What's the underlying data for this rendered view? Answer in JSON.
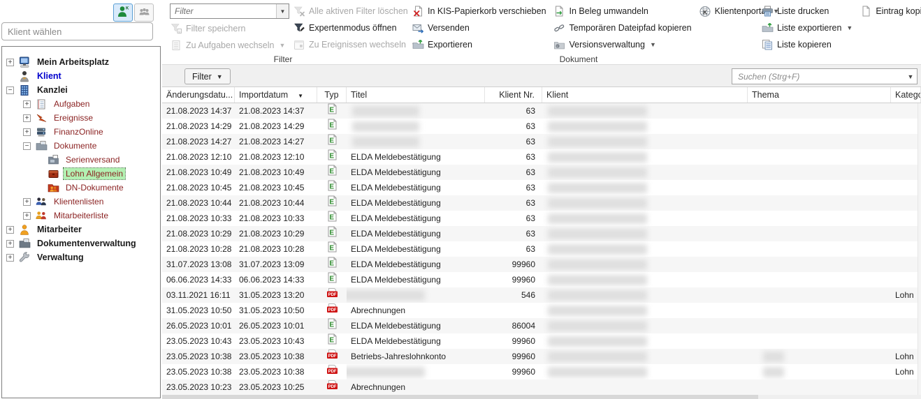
{
  "colors": {
    "accent_selected_tree": "#b2f0b2",
    "tree_branch_text": "#8b2323",
    "client_link_blue": "#0000cd",
    "elda_green": "#2e8b2e",
    "pdf_red": "#cf1414",
    "active_button_border": "#5a9fd4",
    "filter_bar_bg": "#f0f0f0"
  },
  "topleft": {
    "single_client_button_icon": "client-icon",
    "client_group_button_icon": "group-icon"
  },
  "client_search": {
    "placeholder": "Klient wählen"
  },
  "tree": {
    "items": [
      {
        "label": "Mein Arbeitsplatz",
        "level": 0,
        "expander": "plus",
        "icon": "workstation-icon",
        "style": "bold"
      },
      {
        "label": "Klient",
        "level": 0,
        "expander": null,
        "icon": "client-person-icon",
        "style": "blue"
      },
      {
        "label": "Kanzlei",
        "level": 0,
        "expander": "minus",
        "icon": "office-icon",
        "style": "bold"
      },
      {
        "label": "Aufgaben",
        "level": 1,
        "expander": "plus",
        "icon": "tasks-icon",
        "style": "red"
      },
      {
        "label": "Ereignisse",
        "level": 1,
        "expander": "plus",
        "icon": "events-icon",
        "style": "red"
      },
      {
        "label": "FinanzOnline",
        "level": 1,
        "expander": "plus",
        "icon": "finanzonline-icon",
        "style": "red"
      },
      {
        "label": "Dokumente",
        "level": 1,
        "expander": "minus",
        "icon": "documents-icon",
        "style": "red"
      },
      {
        "label": "Serienversand",
        "level": 2,
        "expander": null,
        "icon": "serienversand-icon",
        "style": "red"
      },
      {
        "label": "Lohn Allgemein",
        "level": 2,
        "expander": null,
        "icon": "lohn-icon",
        "style": "red",
        "selected": true
      },
      {
        "label": "DN-Dokumente",
        "level": 2,
        "expander": null,
        "icon": "dn-dokumente-icon",
        "style": "red"
      },
      {
        "label": "Klientenlisten",
        "level": 1,
        "expander": "plus",
        "icon": "clientlists-icon",
        "style": "red"
      },
      {
        "label": "Mitarbeiterliste",
        "level": 1,
        "expander": "plus",
        "icon": "stafflist-icon",
        "style": "red"
      },
      {
        "label": "Mitarbeiter",
        "level": 0,
        "expander": "plus",
        "icon": "staff-icon",
        "style": "bold"
      },
      {
        "label": "Dokumentenverwaltung",
        "level": 0,
        "expander": "plus",
        "icon": "docmgmt-icon",
        "style": "bold"
      },
      {
        "label": "Verwaltung",
        "level": 0,
        "expander": "plus",
        "icon": "admin-icon",
        "style": "bold"
      }
    ]
  },
  "toolbar": {
    "groups": [
      {
        "name": "filter",
        "label": "Filter",
        "columns": [
          [
            {
              "type": "combo",
              "placeholder": "Filter",
              "icon": "combo-arrow-icon"
            },
            {
              "label": "Filter speichern",
              "icon": "filter-save-icon",
              "disabled": true
            },
            {
              "label": "Zu Aufgaben wechseln",
              "icon": "switch-tasks-icon",
              "disabled": true,
              "dropdown": true
            }
          ],
          [
            {
              "label": "Alle aktiven Filter löschen",
              "icon": "filter-clear-icon",
              "disabled": true
            },
            {
              "label": "Expertenmodus öffnen",
              "icon": "filter-expert-icon",
              "disabled": false
            },
            {
              "label": "Zu Ereignissen wechseln",
              "icon": "switch-events-icon",
              "disabled": true,
              "dropdown": true
            }
          ]
        ]
      },
      {
        "name": "dokument",
        "label": "Dokument",
        "columns": [
          [
            {
              "label": "In KIS-Papierkorb verschieben",
              "icon": "kis-trash-icon"
            },
            {
              "label": "Versenden",
              "icon": "versenden-icon"
            },
            {
              "label": "Exportieren",
              "icon": "export-icon"
            }
          ],
          [
            {
              "label": "In Beleg umwandeln",
              "icon": "beleg-icon"
            },
            {
              "label": "Temporären Dateipfad kopieren",
              "icon": "path-copy-icon"
            },
            {
              "label": "Versionsverwaltung",
              "icon": "versions-icon",
              "dropdown": true
            }
          ],
          [
            {
              "label": "Klientenportal",
              "icon": "klientenportal-icon",
              "dropdown": true
            }
          ]
        ]
      },
      {
        "name": "liste",
        "label": "",
        "columns": [
          [
            {
              "label": "Liste drucken",
              "icon": "print-icon"
            },
            {
              "label": "Liste exportieren",
              "icon": "list-export-icon",
              "dropdown": true
            },
            {
              "label": "Liste kopieren",
              "icon": "copy-list-icon"
            }
          ],
          [
            {
              "label": "Eintrag kopieren",
              "icon": "copy-entry-icon"
            }
          ]
        ]
      }
    ]
  },
  "filter_bar": {
    "filter_button_label": "Filter",
    "search_placeholder": "Suchen (Strg+F)"
  },
  "table": {
    "typ_icons": {
      "elda": "E",
      "pdf": "PDF"
    },
    "columns": [
      {
        "label": "Änderungsdatu...",
        "key": "aenderungsdatum"
      },
      {
        "label": "Importdatum",
        "key": "importdatum",
        "sort": "desc"
      },
      {
        "label": "Typ",
        "key": "typ",
        "align": "center"
      },
      {
        "label": "Titel",
        "key": "titel"
      },
      {
        "label": "Klient Nr.",
        "key": "klient_nr",
        "align": "right"
      },
      {
        "label": "Klient",
        "key": "klient"
      },
      {
        "label": "Thema",
        "key": "thema"
      },
      {
        "label": "Kategor",
        "key": "kategorie"
      }
    ],
    "rows": [
      {
        "aenderungsdatum": "21.08.2023 14:37",
        "importdatum": "21.08.2023 14:37",
        "typ": "elda",
        "titel": "",
        "titel_redacted": true,
        "klient_nr": "63",
        "klient_redacted": true,
        "thema_redacted": false,
        "kategorie": ""
      },
      {
        "aenderungsdatum": "21.08.2023 14:29",
        "importdatum": "21.08.2023 14:29",
        "typ": "elda",
        "titel": "",
        "titel_redacted": true,
        "klient_nr": "63",
        "klient_redacted": true,
        "thema_redacted": false,
        "kategorie": ""
      },
      {
        "aenderungsdatum": "21.08.2023 14:27",
        "importdatum": "21.08.2023 14:27",
        "typ": "elda",
        "titel": "",
        "titel_redacted": true,
        "klient_nr": "63",
        "klient_redacted": true,
        "thema_redacted": false,
        "kategorie": ""
      },
      {
        "aenderungsdatum": "21.08.2023 12:10",
        "importdatum": "21.08.2023 12:10",
        "typ": "elda",
        "titel": "ELDA Meldebestätigung",
        "titel_redacted": false,
        "klient_nr": "63",
        "klient_redacted": true,
        "thema_redacted": false,
        "kategorie": ""
      },
      {
        "aenderungsdatum": "21.08.2023 10:49",
        "importdatum": "21.08.2023 10:49",
        "typ": "elda",
        "titel": "ELDA Meldebestätigung",
        "titel_redacted": false,
        "klient_nr": "63",
        "klient_redacted": true,
        "thema_redacted": false,
        "kategorie": ""
      },
      {
        "aenderungsdatum": "21.08.2023 10:45",
        "importdatum": "21.08.2023 10:45",
        "typ": "elda",
        "titel": "ELDA Meldebestätigung",
        "titel_redacted": false,
        "klient_nr": "63",
        "klient_redacted": true,
        "thema_redacted": false,
        "kategorie": ""
      },
      {
        "aenderungsdatum": "21.08.2023 10:44",
        "importdatum": "21.08.2023 10:44",
        "typ": "elda",
        "titel": "ELDA Meldebestätigung",
        "titel_redacted": false,
        "klient_nr": "63",
        "klient_redacted": true,
        "thema_redacted": false,
        "kategorie": ""
      },
      {
        "aenderungsdatum": "21.08.2023 10:33",
        "importdatum": "21.08.2023 10:33",
        "typ": "elda",
        "titel": "ELDA Meldebestätigung",
        "titel_redacted": false,
        "klient_nr": "63",
        "klient_redacted": true,
        "thema_redacted": false,
        "kategorie": ""
      },
      {
        "aenderungsdatum": "21.08.2023 10:29",
        "importdatum": "21.08.2023 10:29",
        "typ": "elda",
        "titel": "ELDA Meldebestätigung",
        "titel_redacted": false,
        "klient_nr": "63",
        "klient_redacted": true,
        "thema_redacted": false,
        "kategorie": ""
      },
      {
        "aenderungsdatum": "21.08.2023 10:28",
        "importdatum": "21.08.2023 10:28",
        "typ": "elda",
        "titel": "ELDA Meldebestätigung",
        "titel_redacted": false,
        "klient_nr": "63",
        "klient_redacted": true,
        "thema_redacted": false,
        "kategorie": ""
      },
      {
        "aenderungsdatum": "31.07.2023 13:08",
        "importdatum": "31.07.2023 13:09",
        "typ": "elda",
        "titel": "ELDA Meldebestätigung",
        "titel_redacted": false,
        "klient_nr": "99960",
        "klient_redacted": true,
        "thema_redacted": false,
        "kategorie": ""
      },
      {
        "aenderungsdatum": "06.06.2023 14:33",
        "importdatum": "06.06.2023 14:33",
        "typ": "elda",
        "titel": "ELDA Meldebestätigung",
        "titel_redacted": false,
        "klient_nr": "99960",
        "klient_redacted": true,
        "thema_redacted": false,
        "kategorie": ""
      },
      {
        "aenderungsdatum": "03.11.2021 16:11",
        "importdatum": "31.05.2023 13:20",
        "typ": "pdf",
        "titel": "",
        "titel_redacted": true,
        "titel_redact_large": true,
        "klient_nr": "546",
        "klient_redacted": true,
        "thema_redacted": false,
        "kategorie": "Lohn"
      },
      {
        "aenderungsdatum": "31.05.2023 10:50",
        "importdatum": "31.05.2023 10:50",
        "typ": "pdf",
        "titel": "Abrechnungen",
        "titel_redacted": false,
        "klient_nr": "",
        "klient_redacted": true,
        "thema_redacted": false,
        "kategorie": ""
      },
      {
        "aenderungsdatum": "26.05.2023 10:01",
        "importdatum": "26.05.2023 10:01",
        "typ": "elda",
        "titel": "ELDA Meldebestätigung",
        "titel_redacted": false,
        "klient_nr": "86004",
        "klient_redacted": true,
        "thema_redacted": false,
        "kategorie": ""
      },
      {
        "aenderungsdatum": "23.05.2023 10:43",
        "importdatum": "23.05.2023 10:43",
        "typ": "elda",
        "titel": "ELDA Meldebestätigung",
        "titel_redacted": false,
        "klient_nr": "99960",
        "klient_redacted": true,
        "thema_redacted": false,
        "kategorie": ""
      },
      {
        "aenderungsdatum": "23.05.2023 10:38",
        "importdatum": "23.05.2023 10:38",
        "typ": "pdf",
        "titel": "Betriebs-Jahreslohnkonto",
        "titel_redacted": false,
        "klient_nr": "99960",
        "klient_redacted": true,
        "thema_redacted": true,
        "kategorie": "Lohn"
      },
      {
        "aenderungsdatum": "23.05.2023 10:38",
        "importdatum": "23.05.2023 10:38",
        "typ": "pdf",
        "titel": "",
        "titel_redacted": true,
        "titel_redact_large": true,
        "klient_nr": "99960",
        "klient_redacted": true,
        "thema_redacted": true,
        "kategorie": "Lohn"
      },
      {
        "aenderungsdatum": "23.05.2023 10:23",
        "importdatum": "23.05.2023 10:25",
        "typ": "pdf",
        "titel": "Abrechnungen",
        "titel_redacted": false,
        "klient_nr": "",
        "klient_redacted": false,
        "thema_redacted": false,
        "kategorie": ""
      }
    ]
  }
}
